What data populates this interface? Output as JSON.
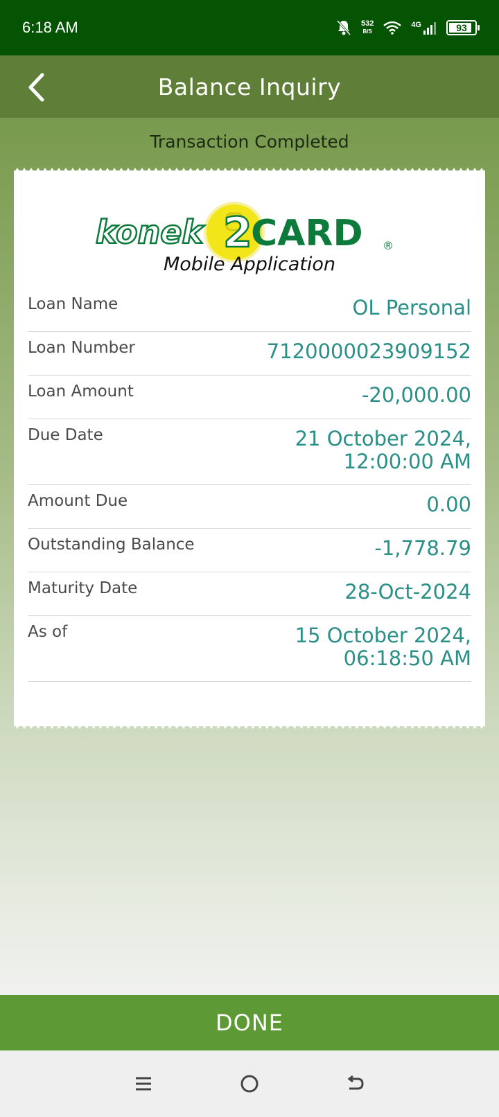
{
  "status_bar": {
    "time": "6:18 AM",
    "net_speed_value": "532",
    "net_speed_unit": "B/S",
    "network_type": "4G",
    "battery": "93",
    "icons": [
      "bell-muted-icon",
      "wifi-icon",
      "signal-icon",
      "battery-icon"
    ]
  },
  "app_bar": {
    "title": "Balance Inquiry",
    "back_icon": "chevron-left-icon"
  },
  "transaction_status": "Transaction Completed",
  "receipt": {
    "logo": {
      "brand_left": "konek",
      "brand_digit": "2",
      "brand_right": "CARD",
      "registered_mark": "®",
      "subtitle": "Mobile Application"
    },
    "rows": [
      {
        "label": "Loan Name",
        "value": "OL Personal"
      },
      {
        "label": "Loan Number",
        "value": "7120000023909152"
      },
      {
        "label": "Loan Amount",
        "value": "-20,000.00"
      },
      {
        "label": "Due Date",
        "value_line1": "21 October 2024,",
        "value_line2": "12:00:00 AM"
      },
      {
        "label": "Amount Due",
        "value": "0.00"
      },
      {
        "label": "Outstanding Balance",
        "value": "-1,778.79"
      },
      {
        "label": "Maturity Date",
        "value": "28-Oct-2024"
      },
      {
        "label": "As of",
        "value_line1": "15 October 2024,",
        "value_line2": "06:18:50 AM"
      }
    ]
  },
  "done_button": "DONE",
  "nav_bar": {
    "icons": [
      "menu-icon",
      "home-icon",
      "back-icon"
    ]
  },
  "colors": {
    "status_bar": "#045404",
    "app_bar": "#5f7f38",
    "value_text": "#2a8f86",
    "done_button": "#5d9a35",
    "logo_green": "#0b7a3a",
    "logo_yellow": "#f2e61a"
  }
}
